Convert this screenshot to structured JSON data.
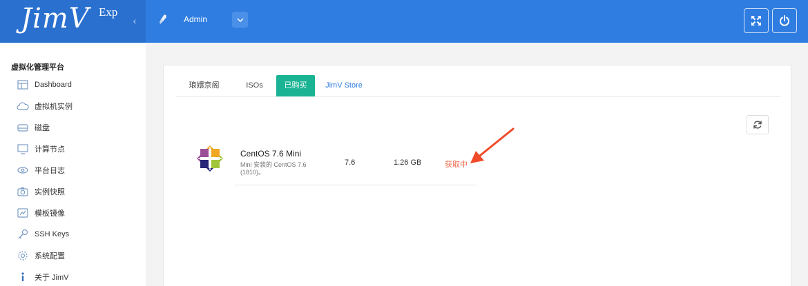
{
  "brand": {
    "logo": "JimV",
    "edition": "Exp"
  },
  "header": {
    "user_name": "Admin"
  },
  "sidebar": {
    "title": "虚拟化管理平台",
    "items": [
      {
        "label": "Dashboard",
        "icon": "dashboard-icon"
      },
      {
        "label": "虚拟机实例",
        "icon": "cloud-icon"
      },
      {
        "label": "磁盘",
        "icon": "disk-icon"
      },
      {
        "label": "计算节点",
        "icon": "monitor-icon"
      },
      {
        "label": "平台日志",
        "icon": "eye-icon"
      },
      {
        "label": "实例快照",
        "icon": "camera-icon"
      },
      {
        "label": "模板镜像",
        "icon": "template-icon"
      },
      {
        "label": "SSH Keys",
        "icon": "key-icon"
      },
      {
        "label": "系统配置",
        "icon": "gear-icon"
      },
      {
        "label": "关于 JimV",
        "icon": "info-icon"
      }
    ]
  },
  "tabs": [
    {
      "label": "琅嬛京阁",
      "active": false
    },
    {
      "label": "ISOs",
      "active": false
    },
    {
      "label": "已购买",
      "active": true
    },
    {
      "label": "JimV Store",
      "active": false
    }
  ],
  "image": {
    "name": "CentOS 7.6 Mini",
    "description": "Mini 安装的 CentOS 7.6 (1810)。",
    "version": "7.6",
    "size": "1.26 GB",
    "status": "获取中"
  },
  "colors": {
    "header": "#2f7de1",
    "brand_bg": "#2a70cf",
    "active_tab": "#1ab394",
    "status": "#ec6a4b",
    "arrow": "#f04a2a"
  }
}
